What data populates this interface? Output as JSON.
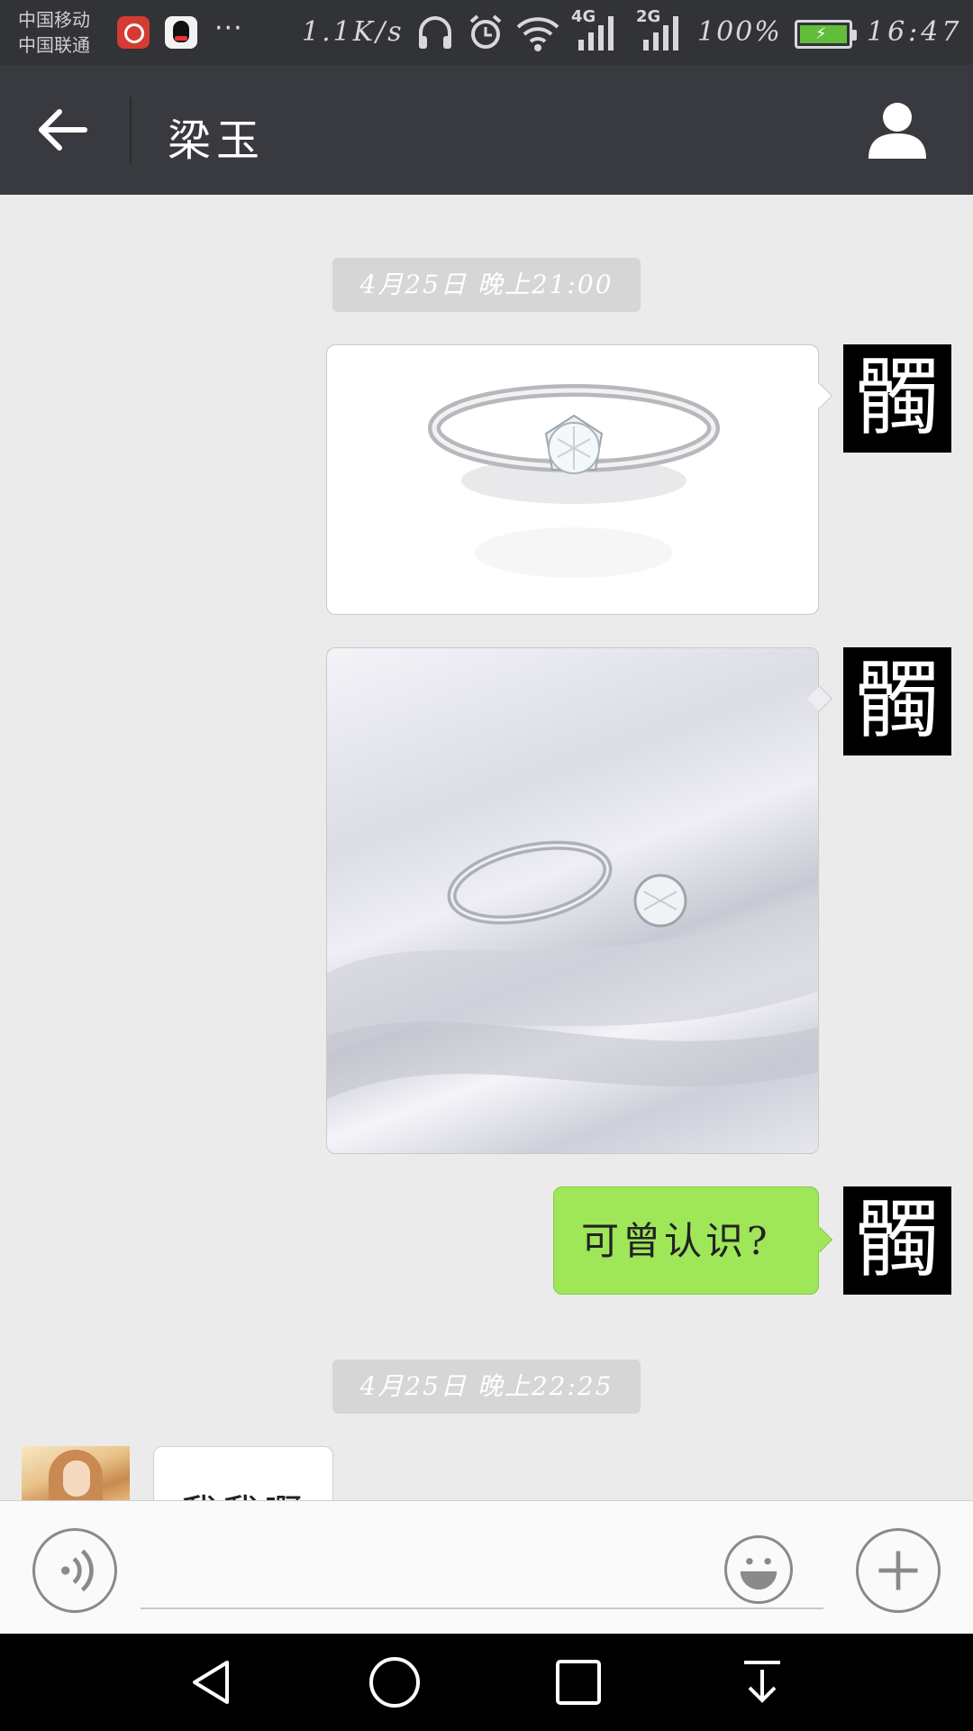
{
  "status_bar": {
    "carrier_1": "中国移动",
    "carrier_2": "中国联通",
    "overflow": "···",
    "net_speed": "1.1K/s",
    "net_4g": "4G",
    "net_2g": "2G",
    "battery_percent": "100%",
    "battery_level": 1.0,
    "time": "16:47",
    "icons": [
      "netease-music-icon",
      "qq-icon",
      "headphones-icon",
      "alarm-icon",
      "wifi-icon",
      "signal-4g-icon",
      "signal-2g-icon",
      "battery-charging-icon"
    ]
  },
  "header": {
    "title": "梁玉",
    "back_icon": "arrow-left-icon",
    "profile_icon": "person-icon"
  },
  "messages": {
    "timestamp_1": "4月25日 晚上21:00",
    "me_avatar_char": "髑",
    "image_1": "diamond-ring-white-background",
    "image_2": "diamond-ring-on-silk",
    "text_1": "可曾认识?",
    "timestamp_2": "4月25日 晚上22:25",
    "other_text_partial": "我我啊",
    "other_avatar": "woman-portrait"
  },
  "input_bar": {
    "voice_icon": "voice-icon",
    "emoji_icon": "emoji-icon",
    "plus_icon": "plus-icon",
    "input_value": ""
  },
  "nav_bar": {
    "icons": [
      "back-triangle-icon",
      "home-circle-icon",
      "recents-square-icon",
      "notification-pulldown-icon"
    ]
  },
  "colors": {
    "status_bar_bg": "#323337",
    "title_bar_bg": "#393a3f",
    "chat_bg": "#ebebeb",
    "my_bubble": "#9fe658",
    "timestamp_bg": "#d6d6d6"
  }
}
